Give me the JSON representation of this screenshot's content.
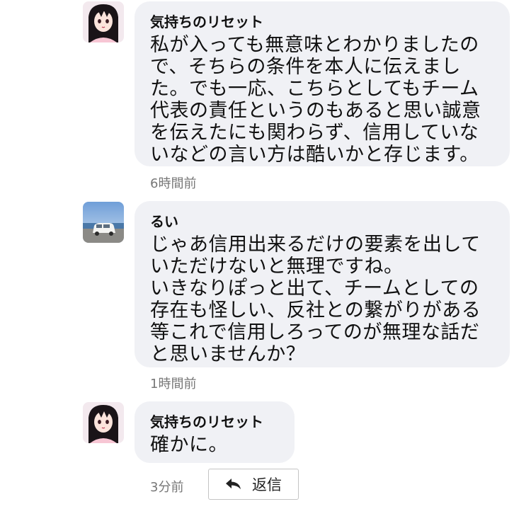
{
  "comments": [
    {
      "author": "気持ちのリセット",
      "body": "私が入っても無意味とわかりましたので、そちらの条件を本人に伝えました。でも一応、こちらとしてもチーム代表の責任というのもあると思い誠意を伝えたにも関わらず、信用していないなどの言い方は酷いかと存じます。",
      "time": "6時間前",
      "avatar_icon": "anime-girl-avatar-icon"
    },
    {
      "author": "るい",
      "body": "じゃあ信用出来るだけの要素を出していただけないと無理ですね。\nいきなりぽっと出て、チームとしての存在も怪しい、反社との繋がりがある等これで信用しろってのが無理な話だと思いませんか？",
      "time": "1時間前",
      "avatar_icon": "white-car-avatar-icon"
    },
    {
      "author": "気持ちのリセット",
      "body": "確かに。",
      "time": "3分前",
      "avatar_icon": "anime-girl-avatar-icon"
    }
  ],
  "reply_button": {
    "label": "返信",
    "icon": "reply-arrow-icon"
  },
  "colors": {
    "bubble": "#f0f1f5",
    "text": "#111111",
    "timestamp": "#777777",
    "button_border": "#c4c4c4"
  }
}
